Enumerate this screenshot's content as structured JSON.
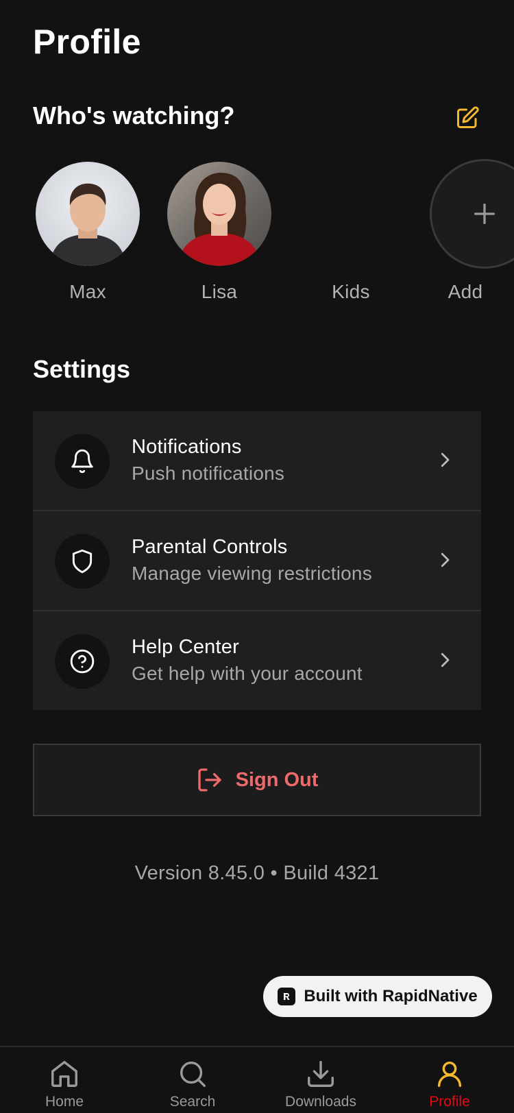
{
  "header": {
    "title": "Profile"
  },
  "profiles_section": {
    "title": "Who's watching?",
    "edit_icon": "edit-icon",
    "profiles": [
      {
        "name": "Max"
      },
      {
        "name": "Lisa"
      },
      {
        "name": "Kids"
      },
      {
        "name": "Add"
      }
    ]
  },
  "settings": {
    "title": "Settings",
    "items": [
      {
        "title": "Notifications",
        "subtitle": "Push notifications",
        "icon": "bell-icon"
      },
      {
        "title": "Parental Controls",
        "subtitle": "Manage viewing restrictions",
        "icon": "shield-icon"
      },
      {
        "title": "Help Center",
        "subtitle": "Get help with your account",
        "icon": "help-circle-icon"
      }
    ]
  },
  "sign_out": {
    "label": "Sign Out",
    "color": "#ef6a6a"
  },
  "version_text": "Version 8.45.0 • Build 4321",
  "built_with": {
    "label": "Built with RapidNative"
  },
  "bottom_nav": {
    "items": [
      {
        "label": "Home",
        "icon": "home-icon"
      },
      {
        "label": "Search",
        "icon": "search-icon"
      },
      {
        "label": "Downloads",
        "icon": "download-icon"
      },
      {
        "label": "Profile",
        "icon": "user-icon",
        "active": true
      }
    ],
    "active_color": "#e50914",
    "active_icon_color": "#f5b82e"
  },
  "colors": {
    "background": "#121212",
    "card": "#1f1f1f",
    "accent_yellow": "#f5b82e",
    "danger": "#ef6a6a"
  }
}
